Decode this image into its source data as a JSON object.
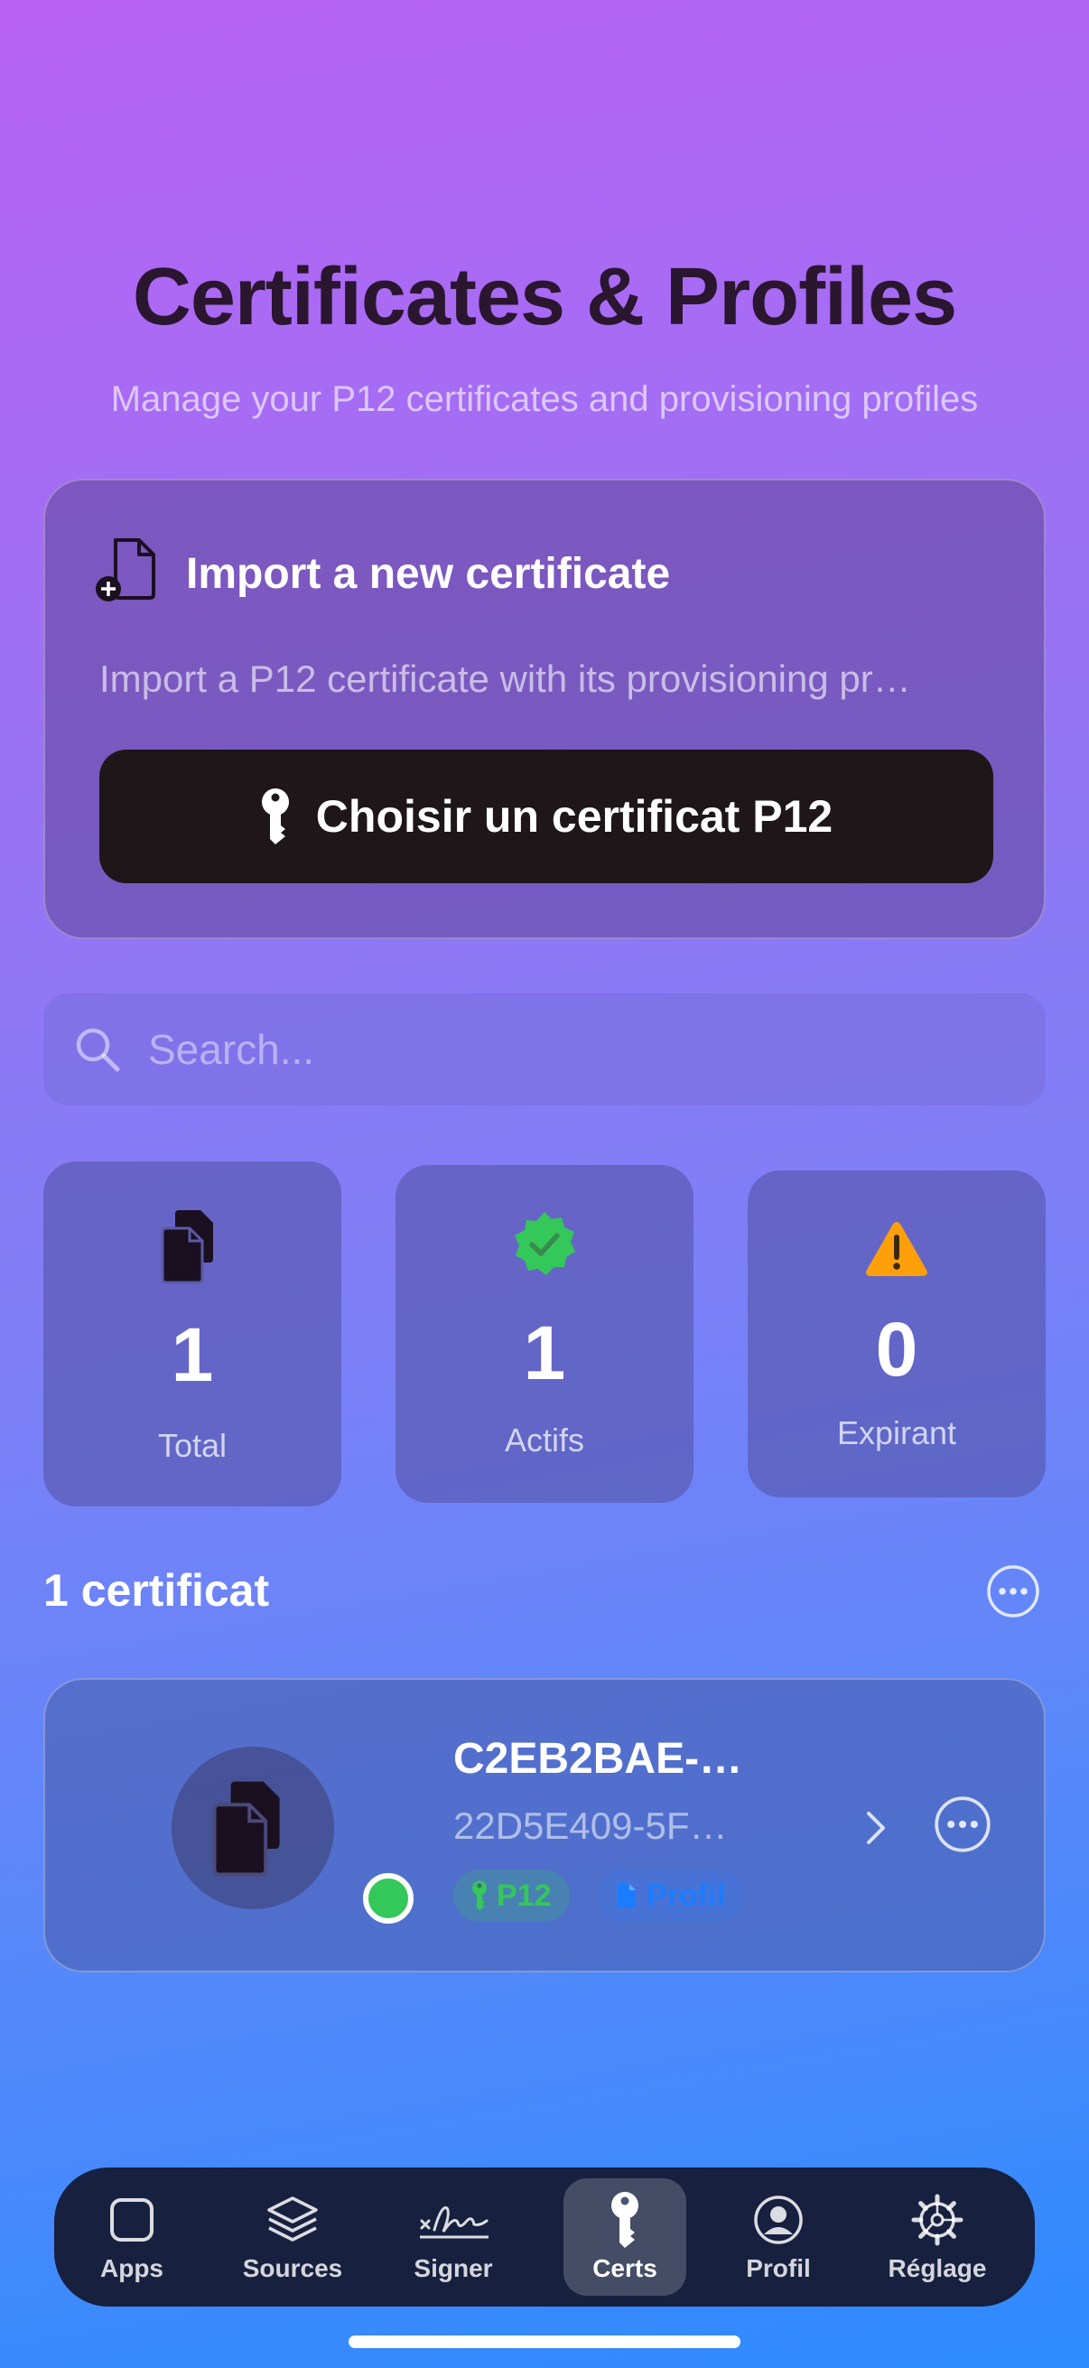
{
  "header": {
    "title": "Certificates & Profiles",
    "subtitle": "Manage your P12 certificates and provisioning profiles"
  },
  "import_card": {
    "title": "Import a new certificate",
    "description": "Import a P12 certificate with its provisioning pr…",
    "button_label": "Choisir un certificat P12"
  },
  "search": {
    "placeholder": "Search..."
  },
  "stats": [
    {
      "value": "1",
      "label": "Total",
      "icon": "documents-icon"
    },
    {
      "value": "1",
      "label": "Actifs",
      "icon": "verified-badge-icon",
      "color": "#34c759"
    },
    {
      "value": "0",
      "label": "Expirant",
      "icon": "warning-triangle-icon",
      "color": "#ff9f0a"
    }
  ],
  "list": {
    "count_label": "1 certificat",
    "items": [
      {
        "name": "C2EB2BAE-…",
        "id": "22D5E409-5F…",
        "status_color": "#34c759",
        "badges": [
          {
            "label": "P12",
            "color": "#34c759"
          },
          {
            "label": "Profil",
            "color": "#1a7dff"
          }
        ]
      }
    ]
  },
  "tabbar": {
    "tabs": [
      {
        "label": "Apps",
        "icon": "square-icon"
      },
      {
        "label": "Sources",
        "icon": "layers-icon"
      },
      {
        "label": "Signer",
        "icon": "signature-icon"
      },
      {
        "label": "Certs",
        "icon": "key-icon",
        "active": true
      },
      {
        "label": "Profil",
        "icon": "person-circle-icon"
      },
      {
        "label": "Réglage",
        "icon": "gear-icon"
      }
    ]
  }
}
